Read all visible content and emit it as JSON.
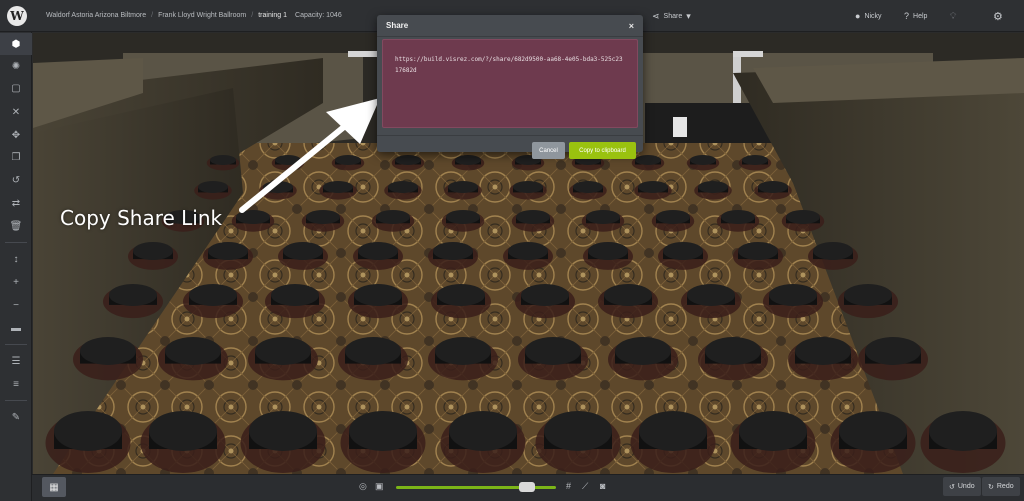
{
  "topbar": {
    "logo_letter": "W",
    "breadcrumbs": [
      {
        "label": "Waldorf Astoria Arizona Biltmore"
      },
      {
        "label": "Frank Lloyd Wright Ballroom"
      },
      {
        "label": "training 1"
      }
    ],
    "capacity": "Capacity: 1046",
    "share_label": "Share",
    "user_label": "Nicky",
    "help_label": "Help"
  },
  "modal": {
    "title": "Share",
    "close_glyph": "×",
    "share_url": "https://build.visrez.com/?/share/682d9500-aa68-4e05-bda3-525c2317682d",
    "cancel_label": "Cancel",
    "copy_label": "Copy to clipboard"
  },
  "annotation": {
    "text": "Copy Share Link"
  },
  "bottombar": {
    "undo_label": "Undo",
    "redo_label": "Redo",
    "zoom_fraction": 0.82
  },
  "colors": {
    "accent_green": "#9ac20f",
    "url_box": "#6e3a4e",
    "toolbar_bg": "#2e3033"
  },
  "icons": {
    "sidebar": [
      "cube-icon",
      "sun-icon",
      "select-box-icon",
      "cross-icon",
      "move-icon",
      "copy-icon",
      "rotate-icon",
      "swap-icon",
      "trash-icon",
      "height-icon",
      "plus-icon",
      "minus-icon",
      "ruler-icon",
      "stack-icon",
      "layers-icon",
      "edit-icon"
    ],
    "top": [
      "user-icon",
      "help-icon",
      "lightbulb-icon",
      "gears-icon",
      "share-icon"
    ],
    "bottom": [
      "map-icon",
      "target-icon",
      "frame-icon",
      "grid-icon",
      "tape-icon",
      "camera-icon"
    ]
  }
}
